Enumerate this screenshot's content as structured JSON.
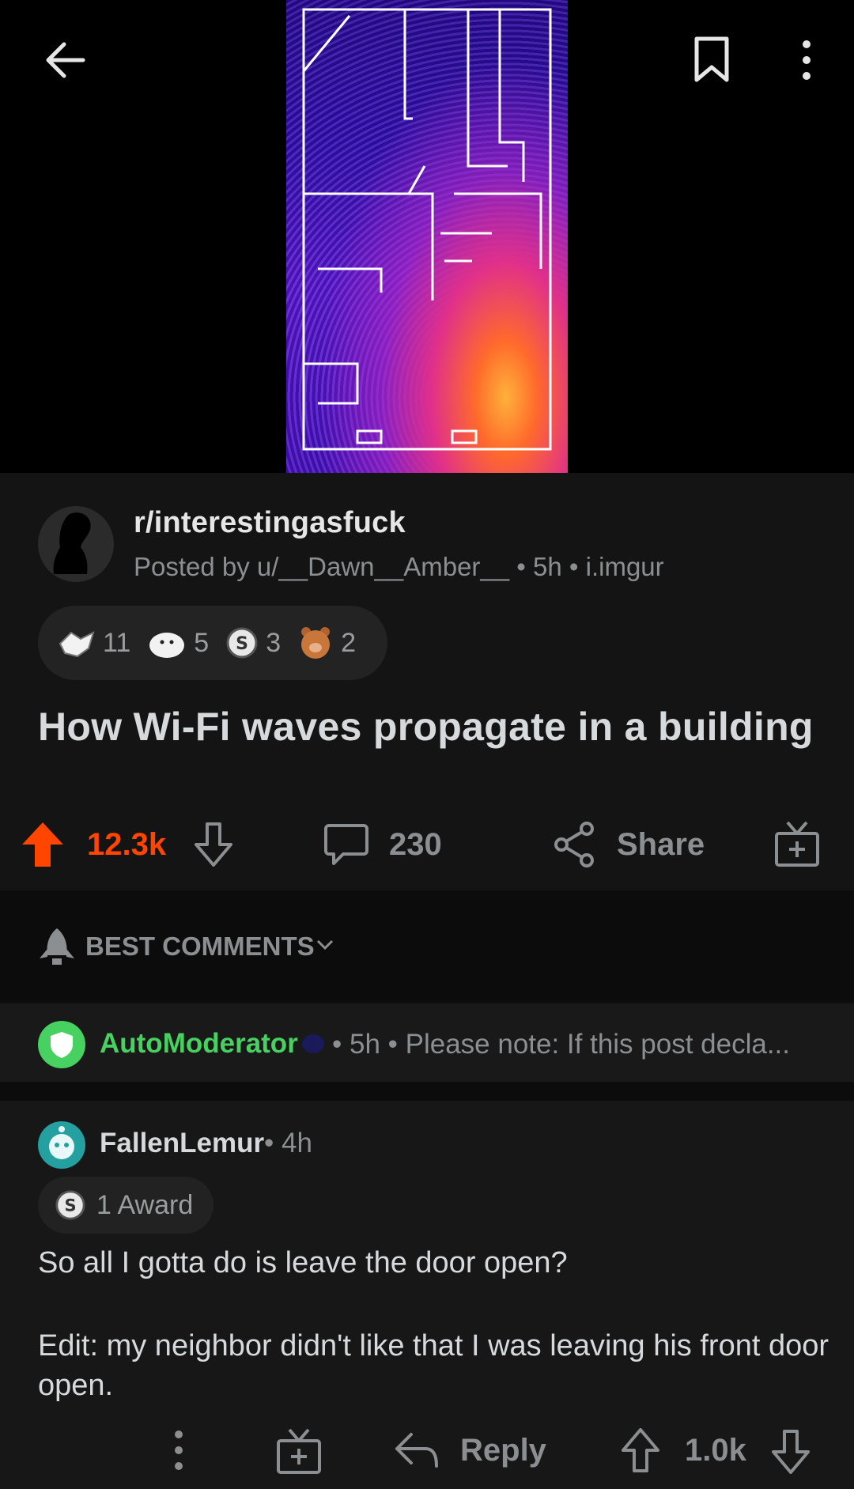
{
  "topbar": {
    "back_icon": "arrow-left-icon",
    "save_icon": "bookmark-icon",
    "more_icon": "more-vertical-icon"
  },
  "post": {
    "subreddit": "r/interestingasfuck",
    "meta": "Posted by u/__Dawn__Amber__ • 5h • i.imgur",
    "awards": [
      {
        "icon": "wholesome-handshake-icon",
        "count": "11"
      },
      {
        "icon": "seal-icon",
        "count": "5"
      },
      {
        "icon": "silver-coin-icon",
        "count": "3"
      },
      {
        "icon": "bear-hug-icon",
        "count": "2"
      }
    ],
    "title": "How Wi-Fi waves propagate in a building",
    "votes": "12.3k",
    "comments": "230",
    "share_label": "Share",
    "upvote_color": "#ff4500"
  },
  "sort": {
    "label": "BEST COMMENTS"
  },
  "automod": {
    "name": "AutoModerator",
    "meta": "• 5h • Please note:  If this post decla...",
    "color": "#46d160"
  },
  "comment": {
    "user": "FallenLemur",
    "time": "• 4h",
    "award_label": "1 Award",
    "body_1": "So all I gotta do is leave the door open?",
    "body_2": "Edit: my neighbor didn't like that I was leaving his front door open.",
    "reply_label": "Reply",
    "votes": "1.0k"
  }
}
